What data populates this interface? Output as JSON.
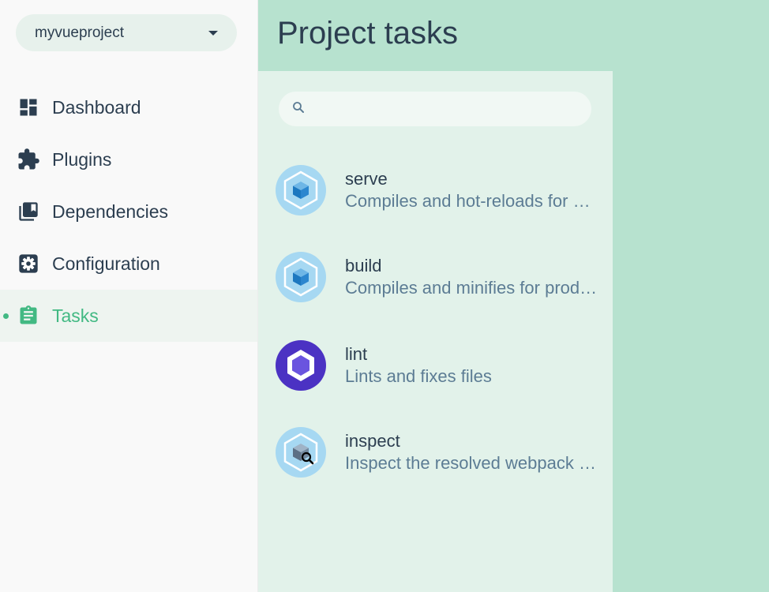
{
  "sidebar": {
    "project_name": "myvueproject",
    "items": [
      {
        "label": "Dashboard",
        "icon": "dashboard-icon"
      },
      {
        "label": "Plugins",
        "icon": "puzzle-icon"
      },
      {
        "label": "Dependencies",
        "icon": "library-icon"
      },
      {
        "label": "Configuration",
        "icon": "gear-icon"
      },
      {
        "label": "Tasks",
        "icon": "clipboard-icon",
        "active": true
      }
    ]
  },
  "header": {
    "title": "Project tasks"
  },
  "search": {
    "placeholder": "",
    "value": ""
  },
  "tasks": [
    {
      "name": "serve",
      "description": "Compiles and hot-reloads for development",
      "icon": "webpack-cube-icon"
    },
    {
      "name": "build",
      "description": "Compiles and minifies for production",
      "icon": "webpack-cube-icon"
    },
    {
      "name": "lint",
      "description": "Lints and fixes files",
      "icon": "eslint-icon"
    },
    {
      "name": "inspect",
      "description": "Inspect the resolved webpack config",
      "icon": "webpack-inspect-icon"
    }
  ],
  "colors": {
    "accent": "#42b983",
    "header_bg": "#b7e2cf",
    "list_bg": "#e2f2ea",
    "text": "#2c3e50",
    "description": "#5c7c94",
    "webpack_light": "#8ed6fb",
    "webpack_dark": "#1c78c0",
    "eslint": "#4b32c3"
  }
}
